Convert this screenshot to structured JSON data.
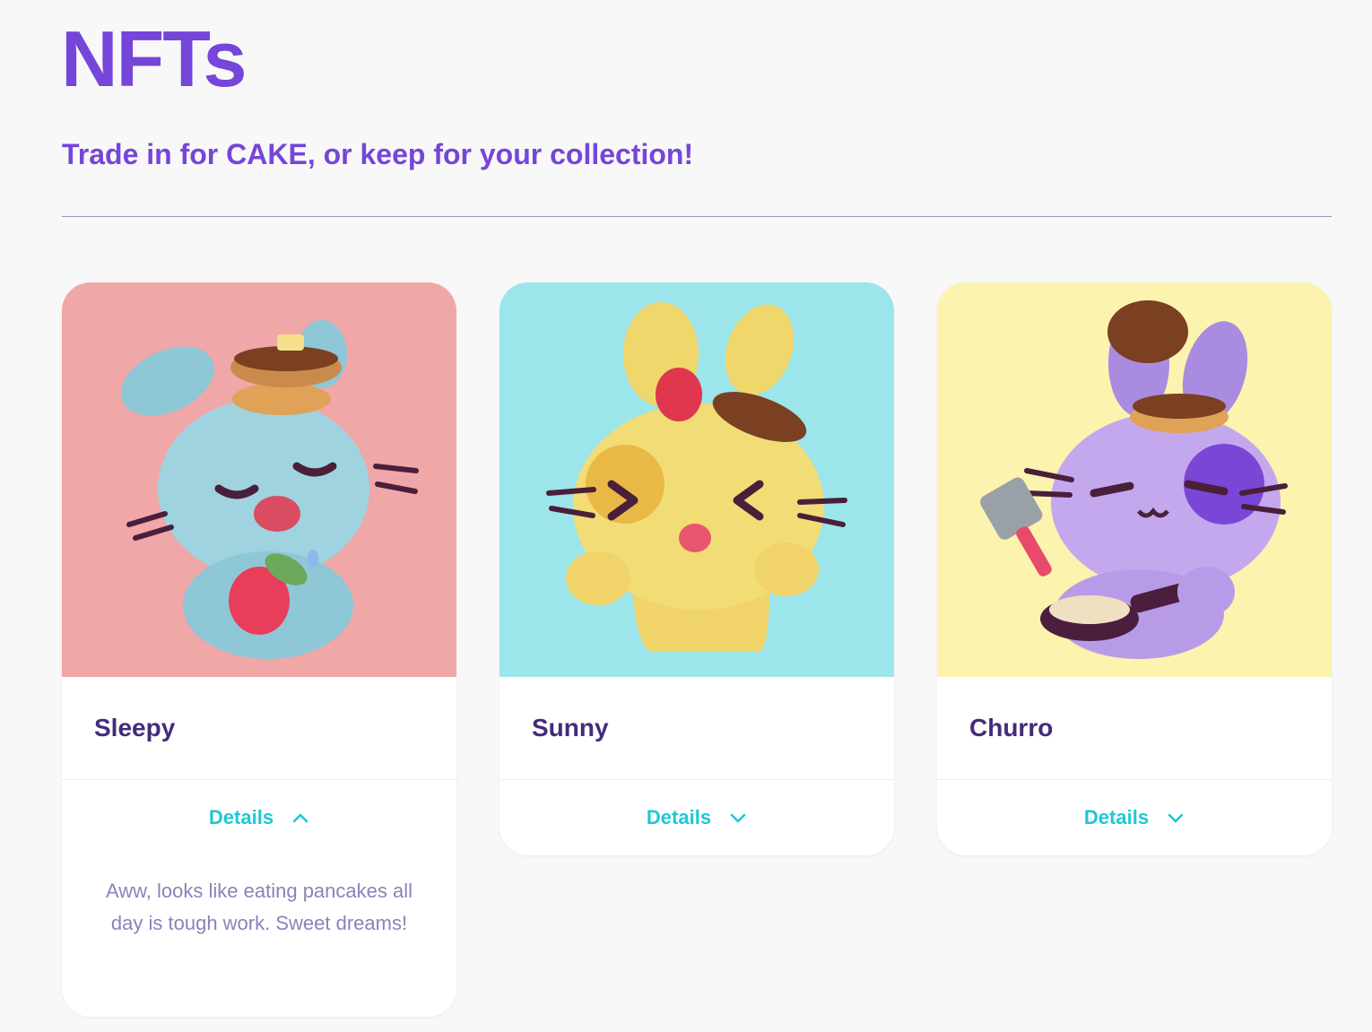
{
  "header": {
    "title": "NFTs",
    "subtitle": "Trade in for CAKE, or keep for your collection!"
  },
  "colors": {
    "brand": "#7645d9",
    "accent": "#1fc7d4",
    "name_text": "#452a7a",
    "desc_text": "#8f80ba"
  },
  "cards": [
    {
      "name": "Sleepy",
      "details_label": "Details",
      "expanded": true,
      "chevron_icon": "chevron-up-icon",
      "description": "Aww, looks like eating pancakes all day is tough work. Sweet dreams!",
      "bg_color": "#efa7a7"
    },
    {
      "name": "Sunny",
      "details_label": "Details",
      "expanded": false,
      "chevron_icon": "chevron-down-icon",
      "bg_color": "#9ce5ea"
    },
    {
      "name": "Churro",
      "details_label": "Details",
      "expanded": false,
      "chevron_icon": "chevron-down-icon",
      "bg_color": "#fbf3ae"
    }
  ]
}
